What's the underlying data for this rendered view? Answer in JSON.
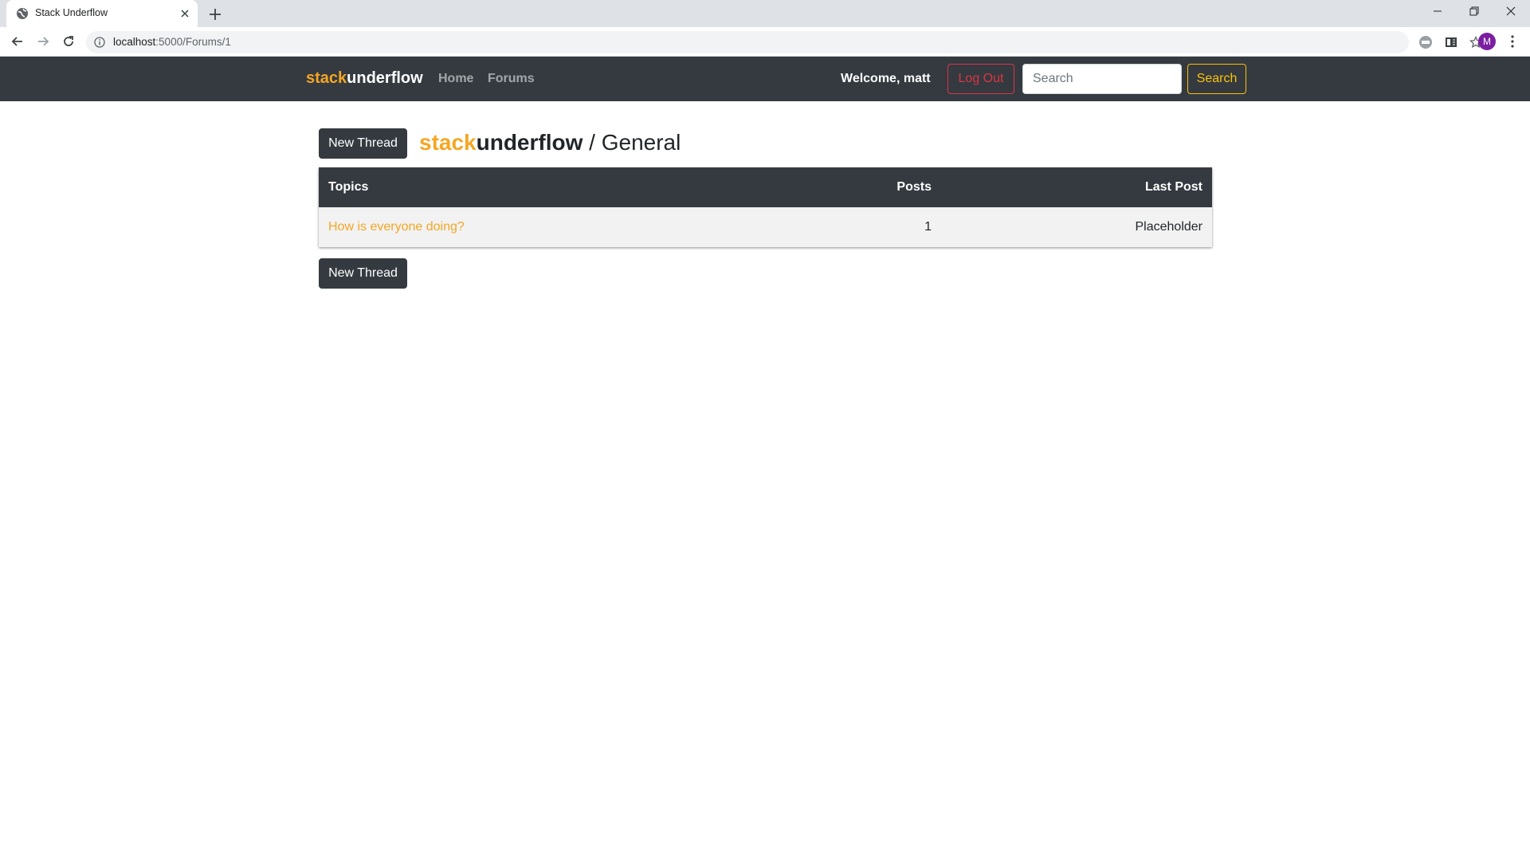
{
  "browser": {
    "tab_title": "Stack Underflow",
    "url_host": "localhost",
    "url_path": ":5000/Forums/1",
    "profile_initial": "M"
  },
  "navbar": {
    "brand_prefix": "stack",
    "brand_suffix": "underflow",
    "links": [
      {
        "label": "Home"
      },
      {
        "label": "Forums"
      }
    ],
    "welcome_text": "Welcome, matt",
    "logout_label": "Log Out",
    "search_placeholder": "Search",
    "search_button_label": "Search"
  },
  "page": {
    "new_thread_label": "New Thread",
    "heading_prefix": "stack",
    "heading_suffix": "underflow",
    "heading_rest": " / General",
    "table": {
      "columns": [
        "Topics",
        "Posts",
        "Last Post"
      ],
      "rows": [
        {
          "topic": "How is everyone doing?",
          "posts": "1",
          "last_post": "Placeholder"
        }
      ]
    }
  },
  "colors": {
    "accent": "#f5a623",
    "navbar_bg": "#343a40",
    "danger": "#dc3545",
    "warning": "#ffc107"
  }
}
